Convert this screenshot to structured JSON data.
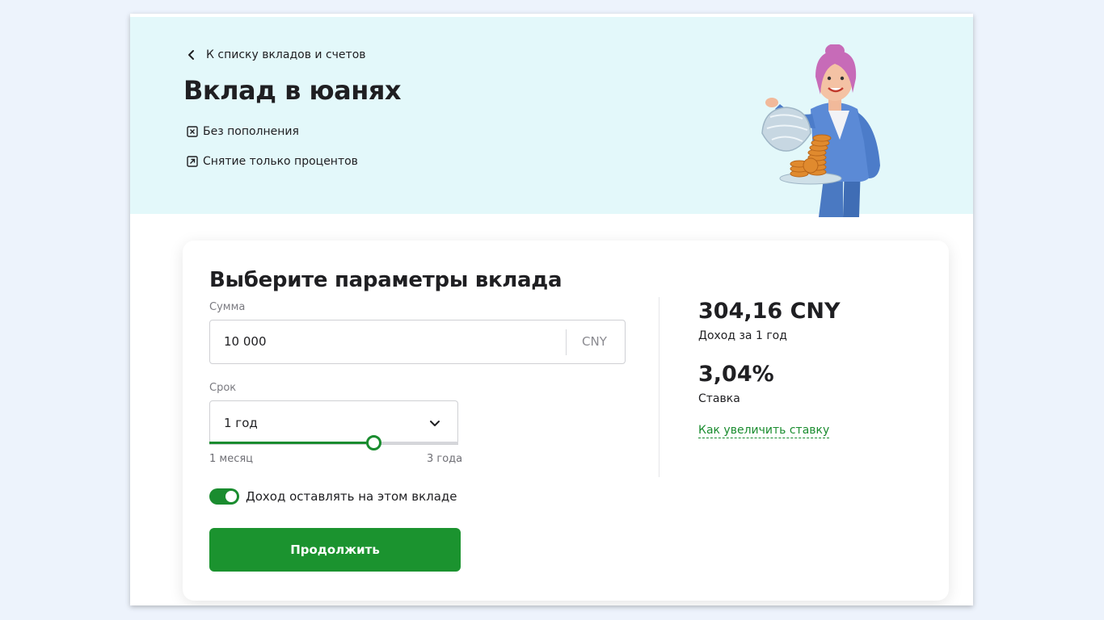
{
  "hero": {
    "back_label": "К списку вкладов и счетов",
    "title": "Вклад в юанях",
    "features": [
      "Без пополнения",
      "Снятие только процентов"
    ]
  },
  "calculator": {
    "title": "Выберите параметры вклада",
    "sum": {
      "label": "Сумма",
      "value": "10 000",
      "currency": "CNY"
    },
    "term": {
      "label": "Срок",
      "value": "1 год",
      "min_label": "1 месяц",
      "max_label": "3 года",
      "slider_fraction": 0.66
    },
    "toggle": {
      "label": "Доход оставлять на этом вкладе",
      "on": true
    },
    "submit_label": "Продолжить"
  },
  "summary": {
    "income_value": "304,16 CNY",
    "income_label": "Доход за 1 год",
    "rate_value": "3,04%",
    "rate_label": "Ставка",
    "rate_link": "Как увеличить ставку"
  },
  "colors": {
    "accent": "#1b932f",
    "hero_bg": "#e3f8fa",
    "page_bg": "#edf3fc"
  },
  "icons": {
    "back": "chevron-left-icon",
    "feature_1": "no-topup-icon",
    "feature_2": "withdraw-interest-icon",
    "dropdown": "chevron-down-icon"
  }
}
